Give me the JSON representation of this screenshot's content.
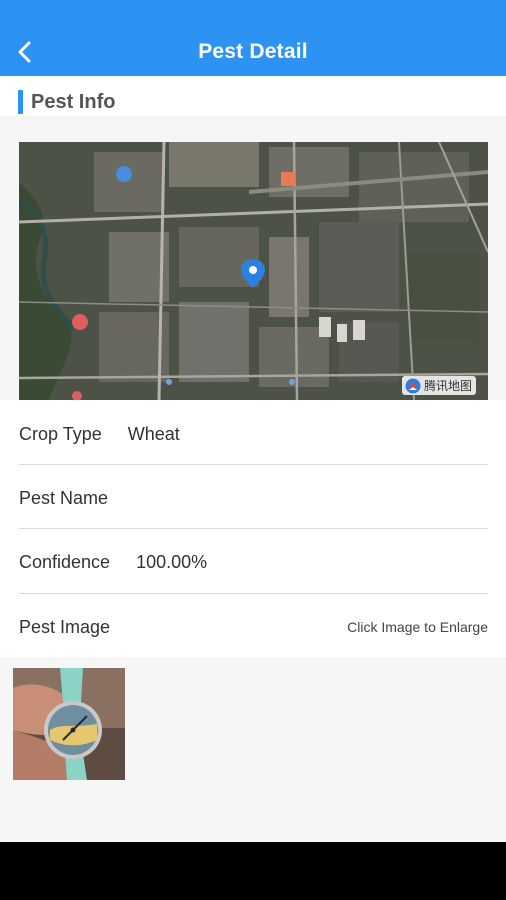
{
  "header": {
    "title": "Pest Detail",
    "back_icon": "chevron-left-icon"
  },
  "section": {
    "title": "Pest Info"
  },
  "map": {
    "provider_label": "腾讯地图",
    "marker_icon": "location-pin-icon"
  },
  "details": {
    "crop_type_label": "Crop Type",
    "crop_type_value": "Wheat",
    "pest_name_label": "Pest Name",
    "pest_name_value": "",
    "confidence_label": "Confidence",
    "confidence_value": "100.00%",
    "pest_image_label": "Pest Image",
    "enlarge_hint": "Click Image to Enlarge"
  },
  "colors": {
    "accent": "#2d93f3",
    "background": "#f6f6f6",
    "divider": "#d9d9d9"
  }
}
